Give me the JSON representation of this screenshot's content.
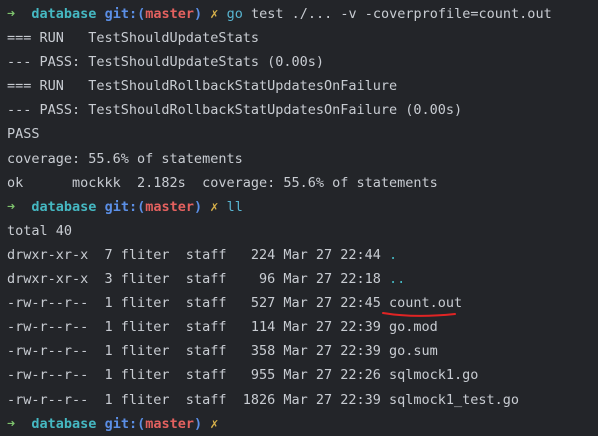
{
  "prompt": {
    "arrow": "➜",
    "dir": "database",
    "git": "git:(",
    "branch": "master",
    "git_close": ")",
    "x": "✗"
  },
  "commands": {
    "c1_name": "go",
    "c1_args": "test ./... -v -coverprofile=count.out",
    "c2_name": "ll"
  },
  "output": {
    "l1": "=== RUN   TestShouldUpdateStats",
    "l2": "--- PASS: TestShouldUpdateStats (0.00s)",
    "l3": "=== RUN   TestShouldRollbackStatUpdatesOnFailure",
    "l4": "--- PASS: TestShouldRollbackStatUpdatesOnFailure (0.00s)",
    "l5": "PASS",
    "l6": "coverage: 55.6% of statements",
    "l7": "ok      mockkk  2.182s  coverage: 55.6% of statements",
    "total": "total 40"
  },
  "listing": [
    {
      "meta": "drwxr-xr-x  7 fliter  staff   224 Mar 27 22:44 ",
      "name": "."
    },
    {
      "meta": "drwxr-xr-x  3 fliter  staff    96 Mar 27 22:18 ",
      "name": ".."
    },
    {
      "meta": "-rw-r--r--  1 fliter  staff   527 Mar 27 22:45 ",
      "name": "count.out"
    },
    {
      "meta": "-rw-r--r--  1 fliter  staff   114 Mar 27 22:39 ",
      "name": "go.mod"
    },
    {
      "meta": "-rw-r--r--  1 fliter  staff   358 Mar 27 22:39 ",
      "name": "go.sum"
    },
    {
      "meta": "-rw-r--r--  1 fliter  staff   955 Mar 27 22:26 ",
      "name": "sqlmock1.go"
    },
    {
      "meta": "-rw-r--r--  1 fliter  staff  1826 Mar 27 22:39 ",
      "name": "sqlmock1_test.go"
    }
  ],
  "colors": {
    "background": "#232529",
    "arrow": "#7ec46d",
    "dir": "#45b8c2",
    "git": "#5b8fe6",
    "branch": "#e4615f",
    "dirty_mark": "#d9b24a",
    "annotation": "#e02424"
  }
}
